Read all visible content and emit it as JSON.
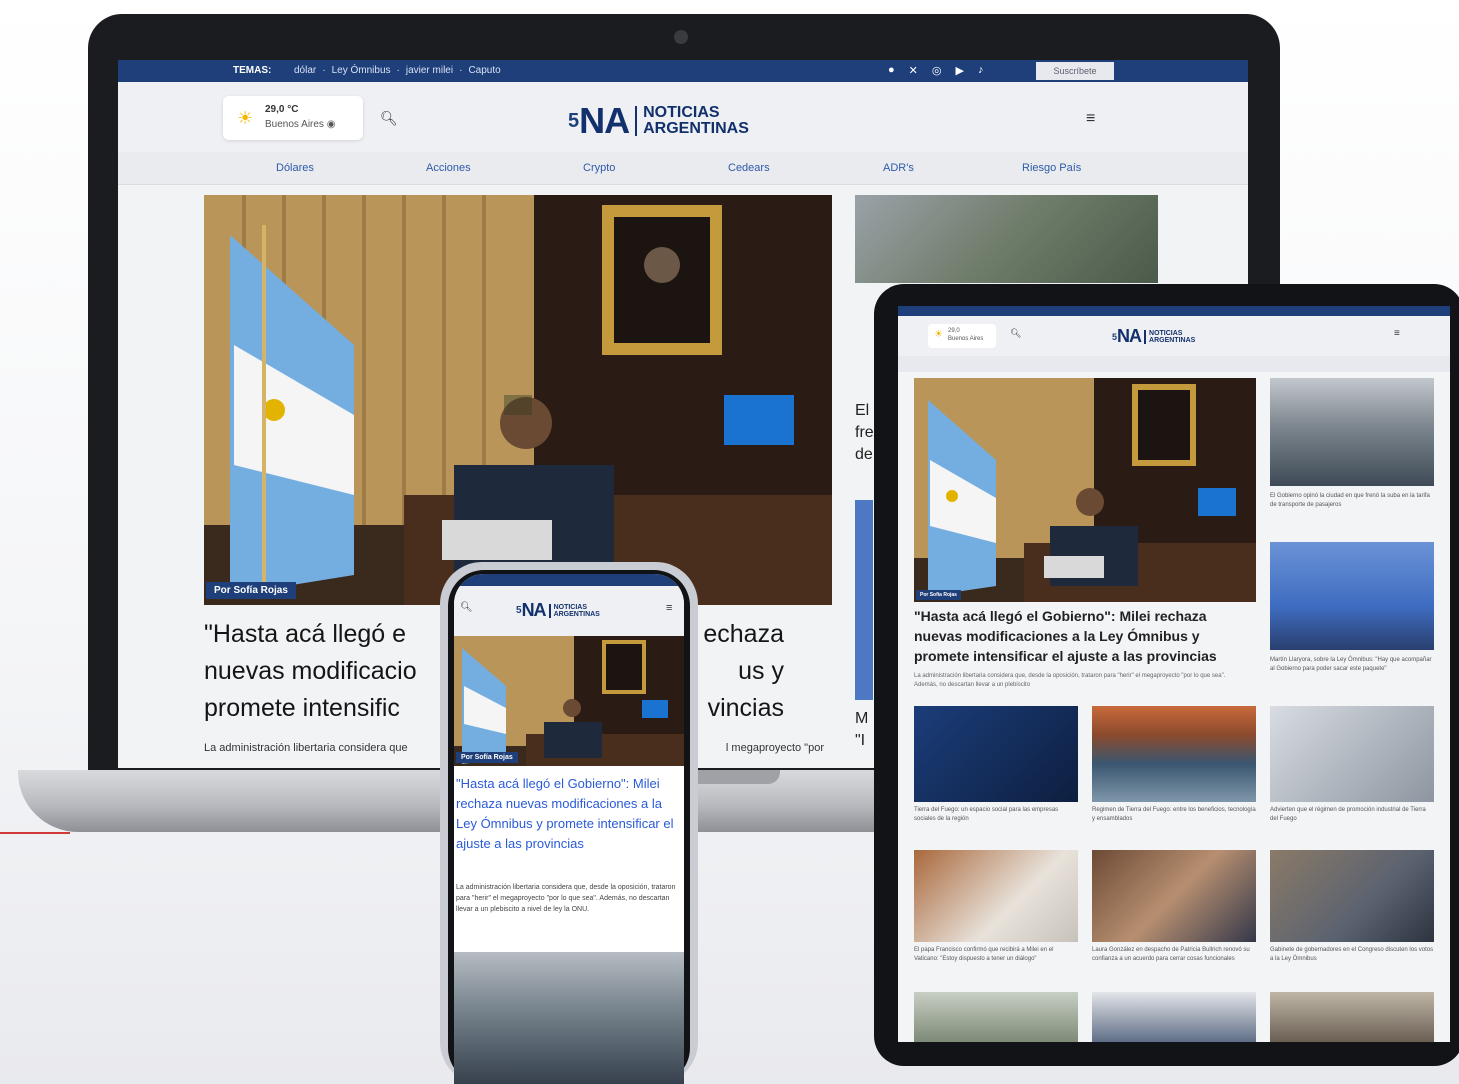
{
  "laptop": {
    "topbar": {
      "temas": "TEMAS:",
      "tags": [
        "dólar",
        "Ley Ómnibus",
        "javier milei",
        "Caputo"
      ],
      "social_icons": [
        "facebook-icon",
        "x-icon",
        "instagram-icon",
        "youtube-icon",
        "tiktok-icon"
      ],
      "subscribe": "Suscríbete"
    },
    "weather": {
      "temp": "29,0 °C",
      "city": "Buenos Aires"
    },
    "logo": {
      "mark": "5",
      "abbr": "NA",
      "line1": "NOTICIAS",
      "line2": "ARGENTINAS"
    },
    "nav": [
      "Dólares",
      "Acciones",
      "Crypto",
      "Cedears",
      "ADR's",
      "Riesgo País"
    ],
    "hero": {
      "byline": "Por Sofía Rojas",
      "title": "\"Hasta acá llegó e",
      "title_tail": "echaza",
      "title_line2": "nuevas modificacio",
      "title_line2_tail": "us y",
      "title_line3": "promete intensific",
      "title_line3_tail": "vincias",
      "summary": "La administración libertaria considera que",
      "summary_tail": "l megaproyecto \"por"
    },
    "side_fragments": [
      "El",
      "fre",
      "de"
    ],
    "side_fragments2": [
      "M",
      "\"I"
    ]
  },
  "tablet": {
    "weather": {
      "temp": "29,0",
      "city": "Buenos Aires"
    },
    "logo": {
      "mark": "5",
      "abbr": "NA",
      "line1": "NOTICIAS",
      "line2": "ARGENTINAS"
    },
    "hero": {
      "byline": "Por Sofía Rojas",
      "title": "\"Hasta acá llegó el Gobierno\": Milei rechaza nuevas modificaciones a la Ley Ómnibus y promete intensificar el ajuste a las provincias",
      "summary": "La administración libertaria considera que, desde la oposición, trataron para \"herir\" el megaproyecto \"por lo que sea\". Además, no descartan llevar a un plebiscito"
    },
    "side_captions": [
      "El Gobierno opinó la ciudad en que frenó la suba en la tarifa de transporte de pasajeros",
      "Martín Llaryora, sobre la Ley Ómnibus: \"Hay que acompañar al Gobierno para poder sacar este paquete\""
    ],
    "grid_captions": [
      "Tierra del Fuego: un espacio social para las empresas sociales de la región",
      "Regimen de Tierra del Fuego: entre los beneficios, tecnología y ensamblados",
      "Advierten que el régimen de promoción industrial de Tierra del Fuego",
      "El papa Francisco confirmó que recibirá a Milei en el Vaticano: \"Estoy dispuesto a tener un diálogo\"",
      "Laura González en despacho de Patricia Bullrich renovó su confianza a un acuerdo para cerrar cosas funcionales",
      "Gabinete de gobernadores en el Congreso discuten los votos a la Ley Ómnibus"
    ]
  },
  "phone": {
    "logo": {
      "mark": "5",
      "abbr": "NA",
      "line1": "NOTICIAS",
      "line2": "ARGENTINAS"
    },
    "byline": "Por Sofía Rojas",
    "title": "\"Hasta acá llegó el Gobierno\": Milei rechaza nuevas modificaciones a la Ley Ómnibus y promete intensificar el ajuste a las provincias",
    "summary": "La administración libertaria considera que, desde la oposición, trataron para \"herir\" el megaproyecto \"por lo que sea\". Además, no descartan llevar a un plebiscito a nivel de ley la ONU."
  },
  "colors": {
    "brand_navy": "#1f3f7a",
    "link_blue": "#2a5bd7",
    "flag_blue": "#74aee0"
  }
}
